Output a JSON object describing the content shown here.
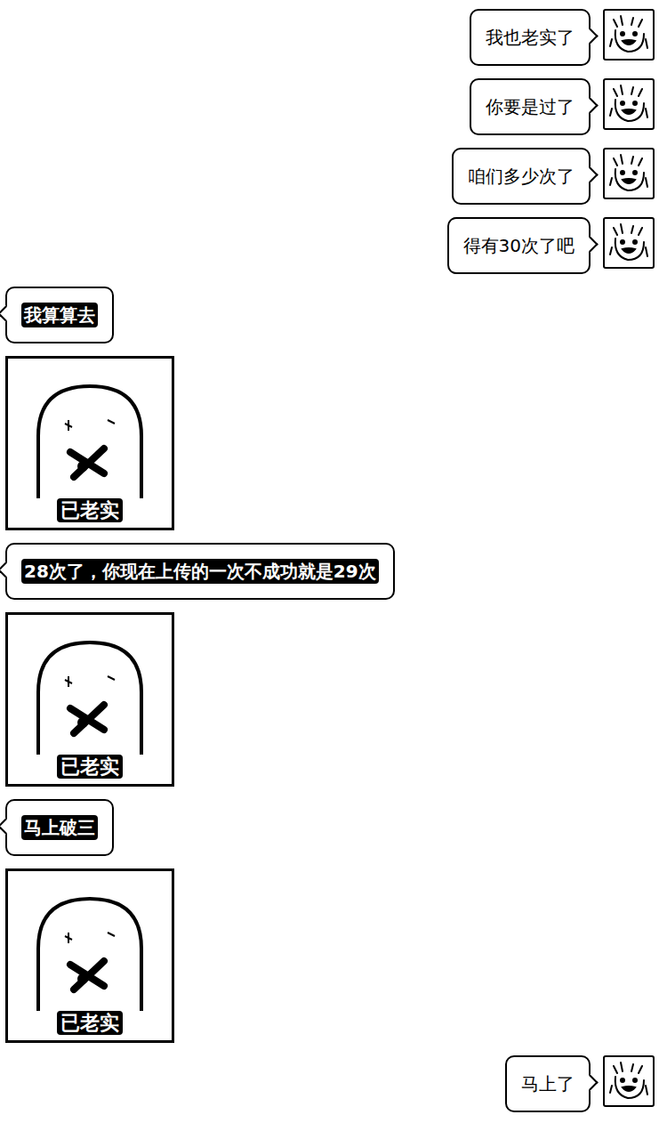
{
  "messages": [
    {
      "sender": "me",
      "kind": "text",
      "text": "我也老实了"
    },
    {
      "sender": "me",
      "kind": "text",
      "text": "你要是过了"
    },
    {
      "sender": "me",
      "kind": "text",
      "text": "咱们多少次了"
    },
    {
      "sender": "me",
      "kind": "text",
      "text": "得有30次了吧"
    },
    {
      "sender": "other",
      "kind": "text",
      "text": "我算算去"
    },
    {
      "sender": "other",
      "kind": "sticker",
      "text": "已老实"
    },
    {
      "sender": "other",
      "kind": "text",
      "text": "28次了，你现在上传的一次不成功就是29次"
    },
    {
      "sender": "other",
      "kind": "sticker",
      "text": "已老实"
    },
    {
      "sender": "other",
      "kind": "text",
      "text": "马上破三"
    },
    {
      "sender": "other",
      "kind": "sticker",
      "text": "已老实"
    },
    {
      "sender": "me",
      "kind": "text",
      "text": "马上了"
    }
  ]
}
